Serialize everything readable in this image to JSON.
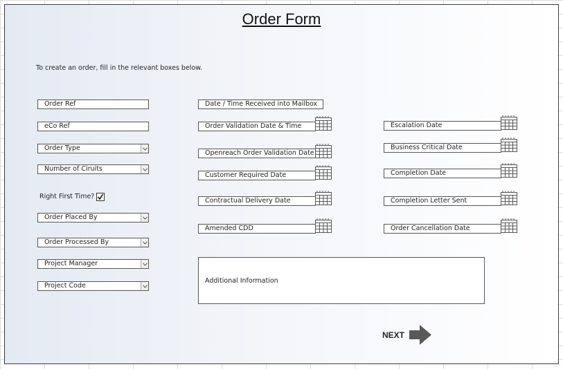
{
  "form": {
    "title": "Order Form",
    "instructions": "To create an order, fill in the relevant boxes below."
  },
  "left_column": {
    "order_ref": "Order Ref",
    "eco_ref": "eCo Ref",
    "order_type": "Order Type",
    "number_of_circuits": "Number of Ciruits",
    "right_first_time_label": "Right First Time?",
    "right_first_time_checked": true,
    "order_placed_by": "Order Placed By",
    "order_processed_by": "Order Processed By",
    "project_manager": "Project Manager",
    "project_code": "Project Code"
  },
  "middle_column": {
    "date_time_received": "Date / Time Received into Mailbox",
    "order_validation_date": "Order Validation Date & Time",
    "openreach_validation_date": "Openreach Order Validation Date",
    "customer_required_date": "Customer Required Date",
    "contractual_delivery_date": "Contractual Delivery Date",
    "amended_cdd": "Amended CDD"
  },
  "right_column": {
    "escalation_date": "Escalation Date",
    "business_critical_date": "Business Critical Date",
    "completion_date": "Completion Date",
    "completion_letter_sent": "Completion Letter Sent",
    "order_cancellation_date": "Order Cancellation Date"
  },
  "additional_info": {
    "label": "Additional Information"
  },
  "navigation": {
    "next_label": "NEXT"
  },
  "icons": {
    "calendar": "calendar-icon",
    "dropdown": "chevron-down-icon",
    "next_arrow": "arrow-right-icon",
    "checkbox": "checkmark-icon"
  }
}
